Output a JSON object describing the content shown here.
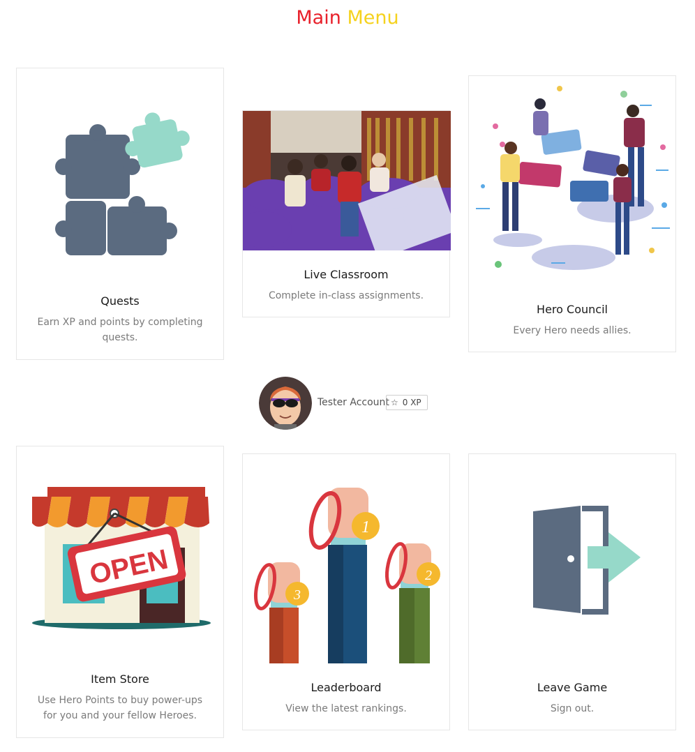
{
  "header": {
    "title_word1": "Main",
    "title_word2": "Menu"
  },
  "colors": {
    "title_main": "#e8212b",
    "title_menu": "#f5d21e",
    "puzzle_gray": "#5b6b80",
    "puzzle_mint": "#96d9c9"
  },
  "cards": [
    {
      "title": "Quests",
      "description": "Earn XP and points by completing quests.",
      "icon": "puzzle-pieces-icon"
    },
    {
      "title": "Live Classroom",
      "description": "Complete in-class assignments.",
      "icon": "classroom-photo"
    },
    {
      "title": "Hero Council",
      "description": "Every Hero needs allies.",
      "icon": "team-puzzle-illustration"
    },
    {
      "title": "Item Store",
      "description": "Use Hero Points to buy power-ups for you and your fellow Heroes.",
      "icon": "open-shop-illustration"
    },
    {
      "title": "Leaderboard",
      "description": "View the latest rankings.",
      "icon": "medals-illustration"
    },
    {
      "title": "Leave Game",
      "description": "Sign out.",
      "icon": "exit-door-icon"
    }
  ],
  "profile": {
    "name": "Tester Account",
    "xp": "0 XP",
    "star_icon": "star-outline-icon"
  },
  "store_sign": "OPEN",
  "medals": [
    "1",
    "2",
    "3"
  ]
}
